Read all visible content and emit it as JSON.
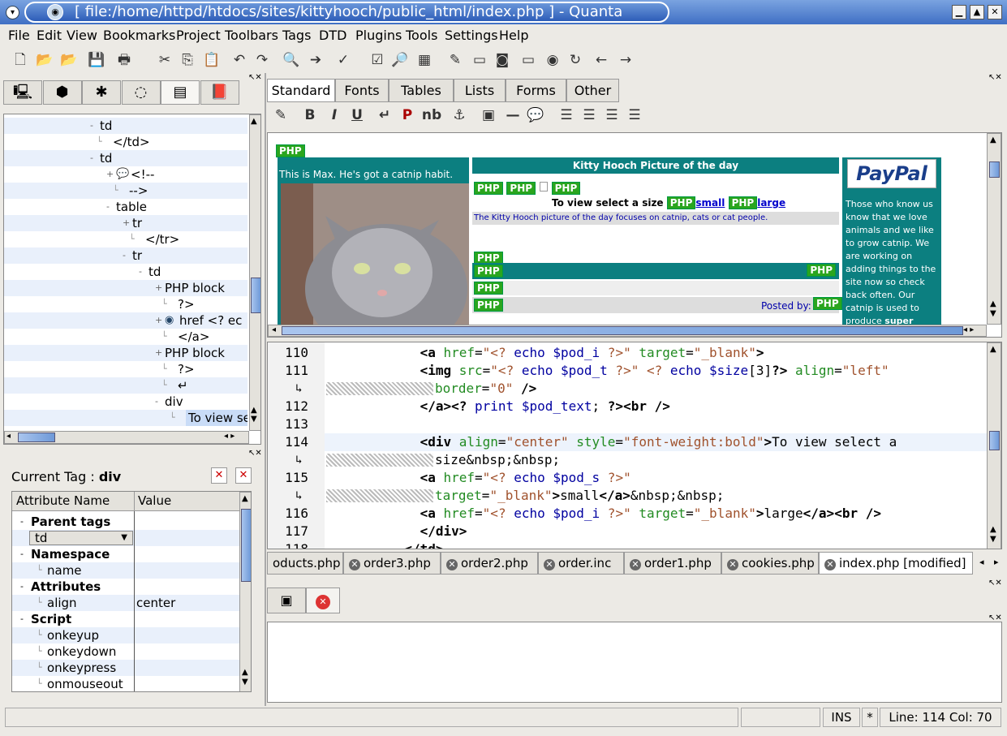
{
  "window": {
    "title": "[  file:/home/httpd/htdocs/sites/kittyhooch/public_html/index.php  ]  - Quanta"
  },
  "menu": [
    "File",
    "Edit",
    "View",
    "Bookmarks",
    "Project",
    "Toolbars",
    "Tags",
    "DTD",
    "Plugins",
    "Tools",
    "Settings",
    "Help"
  ],
  "toolbar_icons": [
    "new-file-icon",
    "open-icon",
    "open-recent-icon",
    "save-icon",
    "print-icon",
    "cut-icon",
    "copy-icon",
    "paste-icon",
    "undo-icon",
    "redo-icon",
    "find-icon",
    "find-next-icon",
    "spellcheck-icon",
    "checkbox-icon",
    "preview-icon",
    "tag-icon",
    "edit-icon",
    "page-icon",
    "view-icon",
    "page2-icon",
    "eye-icon",
    "reload-icon",
    "back-icon",
    "forward-icon"
  ],
  "left_tabs": [
    "computer-icon",
    "objects-icon",
    "document-icon",
    "globe-icon",
    "structure-icon",
    "book-icon"
  ],
  "structure_tree": [
    {
      "indent": 110,
      "label": "td",
      "expander": "-"
    },
    {
      "indent": 126,
      "label": "</td>",
      "expander": ""
    },
    {
      "indent": 110,
      "label": "td",
      "expander": "-"
    },
    {
      "indent": 130,
      "label": "<!--",
      "expander": "+",
      "icon": "comment-icon"
    },
    {
      "indent": 146,
      "label": "-->",
      "expander": ""
    },
    {
      "indent": 130,
      "label": "table",
      "expander": "-"
    },
    {
      "indent": 150,
      "label": "tr",
      "expander": "+"
    },
    {
      "indent": 166,
      "label": "</tr>",
      "expander": ""
    },
    {
      "indent": 150,
      "label": "tr",
      "expander": "-"
    },
    {
      "indent": 170,
      "label": "td",
      "expander": "-"
    },
    {
      "indent": 190,
      "label": "PHP block",
      "expander": "+"
    },
    {
      "indent": 206,
      "label": "?>",
      "expander": ""
    },
    {
      "indent": 190,
      "label": "href <? ec",
      "expander": "+",
      "icon": "link-icon"
    },
    {
      "indent": 206,
      "label": "</a>",
      "expander": ""
    },
    {
      "indent": 190,
      "label": "PHP block",
      "expander": "+"
    },
    {
      "indent": 206,
      "label": "?>",
      "expander": ""
    },
    {
      "indent": 206,
      "label": "↵",
      "expander": ""
    },
    {
      "indent": 190,
      "label": "div",
      "expander": "-"
    },
    {
      "indent": 216,
      "label": "To view se",
      "expander": "",
      "selected": true
    }
  ],
  "attr_panel": {
    "current_tag_label": "Current Tag : ",
    "current_tag": "div",
    "col_name": "Attribute Name",
    "col_value": "Value",
    "rows": [
      {
        "kind": "group",
        "name": "Parent tags",
        "value": ""
      },
      {
        "kind": "combo",
        "name": "td",
        "value": ""
      },
      {
        "kind": "group",
        "name": "Namespace",
        "value": ""
      },
      {
        "kind": "item",
        "name": "name",
        "value": ""
      },
      {
        "kind": "group",
        "name": "Attributes",
        "value": ""
      },
      {
        "kind": "item",
        "name": "align",
        "value": "center"
      },
      {
        "kind": "group",
        "name": "Script",
        "value": ""
      },
      {
        "kind": "item",
        "name": "onkeyup",
        "value": ""
      },
      {
        "kind": "item",
        "name": "onkeydown",
        "value": ""
      },
      {
        "kind": "item",
        "name": "onkeypress",
        "value": ""
      },
      {
        "kind": "item",
        "name": "onmouseout",
        "value": ""
      }
    ]
  },
  "tag_tabs": [
    "Standard",
    "Fonts",
    "Tables",
    "Lists",
    "Forms",
    "Other"
  ],
  "format_buttons": [
    "quick-start-icon",
    "B",
    "I",
    "U",
    "↵",
    "P",
    "nb",
    "anchor-icon",
    "image-icon",
    "hr-icon",
    "comment-icon",
    "align-left-icon",
    "align-center-icon",
    "align-right-icon",
    "justify-icon"
  ],
  "preview": {
    "php": "PHP",
    "caption_left": "This is Max. He's got a catnip habit.",
    "center_title": "Kitty Hooch Picture of the day",
    "view_text": "To view select a size",
    "small": "small",
    "large": "large",
    "focus_text": "The Kitty Hooch picture of the day focuses on catnip, cats or cat people.",
    "posted_by": "Posted by:",
    "paypal": "PayPal",
    "right_text": "Those who know us know that we love animals and we like to grow catnip. We are working on adding things to the site now so check back often. Our catnip is used to produce",
    "right_bold": "super"
  },
  "code_lines": [
    {
      "n": "110",
      "wrap": false,
      "parts": [
        [
          "",
          "            "
        ],
        [
          "kw",
          "<a"
        ],
        [
          "at",
          " href"
        ],
        [
          "",
          "="
        ],
        [
          "str",
          "\"<? "
        ],
        [
          "ph",
          "echo"
        ],
        [
          "vr",
          " $pod_i"
        ],
        [
          "str",
          " ?>\""
        ],
        [
          "at",
          " target"
        ],
        [
          "",
          "="
        ],
        [
          "str",
          "\"_blank\""
        ],
        [
          "kw",
          ">"
        ]
      ]
    },
    {
      "n": "111",
      "wrap": false,
      "parts": [
        [
          "",
          "            "
        ],
        [
          "kw",
          "<img"
        ],
        [
          "at",
          " src"
        ],
        [
          "",
          "="
        ],
        [
          "str",
          "\"<? "
        ],
        [
          "ph",
          "echo"
        ],
        [
          "vr",
          " $pod_t"
        ],
        [
          "str",
          " ?>\""
        ],
        [
          "str",
          " <? "
        ],
        [
          "ph",
          "echo"
        ],
        [
          "vr",
          " $size"
        ],
        [
          "",
          "[3]"
        ],
        [
          "kw",
          "?>"
        ],
        [
          "at",
          " align"
        ],
        [
          "",
          "="
        ],
        [
          "str",
          "\"left\""
        ]
      ]
    },
    {
      "n": "",
      "wrap": true,
      "parts": [
        [
          "at",
          "border"
        ],
        [
          "",
          "="
        ],
        [
          "str",
          "\"0\""
        ],
        [
          "kw",
          " />"
        ]
      ]
    },
    {
      "n": "112",
      "wrap": false,
      "parts": [
        [
          "",
          "            "
        ],
        [
          "kw",
          "</a>"
        ],
        [
          "kw",
          "<?"
        ],
        [
          "ph",
          " print"
        ],
        [
          "vr",
          " $pod_text"
        ],
        [
          "",
          ";"
        ],
        [
          "kw",
          " ?>"
        ],
        [
          "kw",
          "<br />"
        ]
      ]
    },
    {
      "n": "113",
      "wrap": false,
      "parts": []
    },
    {
      "n": "114",
      "wrap": false,
      "current": true,
      "parts": [
        [
          "",
          "            "
        ],
        [
          "kw",
          "<div"
        ],
        [
          "at",
          " align"
        ],
        [
          "",
          "="
        ],
        [
          "str",
          "\"center\""
        ],
        [
          "at",
          " style"
        ],
        [
          "",
          "="
        ],
        [
          "str",
          "\"font-weight:bold\""
        ],
        [
          "kw",
          ">"
        ],
        [
          "",
          "To view select a"
        ]
      ]
    },
    {
      "n": "",
      "wrap": true,
      "parts": [
        [
          "",
          "size&nbsp;&nbsp;"
        ]
      ]
    },
    {
      "n": "115",
      "wrap": false,
      "parts": [
        [
          "",
          "            "
        ],
        [
          "kw",
          "<a"
        ],
        [
          "at",
          " href"
        ],
        [
          "",
          "="
        ],
        [
          "str",
          "\"<? "
        ],
        [
          "ph",
          "echo"
        ],
        [
          "vr",
          " $pod_s"
        ],
        [
          "str",
          " ?>\""
        ]
      ]
    },
    {
      "n": "",
      "wrap": true,
      "parts": [
        [
          "at",
          "target"
        ],
        [
          "",
          "="
        ],
        [
          "str",
          "\"_blank\""
        ],
        [
          "kw",
          ">"
        ],
        [
          "",
          "small"
        ],
        [
          "kw",
          "</a>"
        ],
        [
          "",
          "&nbsp;&nbsp;"
        ]
      ]
    },
    {
      "n": "116",
      "wrap": false,
      "parts": [
        [
          "",
          "            "
        ],
        [
          "kw",
          "<a"
        ],
        [
          "at",
          " href"
        ],
        [
          "",
          "="
        ],
        [
          "str",
          "\"<? "
        ],
        [
          "ph",
          "echo"
        ],
        [
          "vr",
          " $pod_i"
        ],
        [
          "str",
          " ?>\""
        ],
        [
          "at",
          " target"
        ],
        [
          "",
          "="
        ],
        [
          "str",
          "\"_blank\""
        ],
        [
          "kw",
          ">"
        ],
        [
          "",
          "large"
        ],
        [
          "kw",
          "</a>"
        ],
        [
          "kw",
          "<br />"
        ]
      ]
    },
    {
      "n": "117",
      "wrap": false,
      "parts": [
        [
          "",
          "            "
        ],
        [
          "kw",
          "</div>"
        ]
      ]
    },
    {
      "n": "118",
      "wrap": false,
      "parts": [
        [
          "",
          "          "
        ],
        [
          "kw",
          "</td>"
        ]
      ]
    }
  ],
  "file_tabs": [
    {
      "label": "oducts.php",
      "close": false
    },
    {
      "label": "order3.php",
      "close": true
    },
    {
      "label": "order2.php",
      "close": true
    },
    {
      "label": "order.inc",
      "close": true
    },
    {
      "label": "order1.php",
      "close": true
    },
    {
      "label": "cookies.php",
      "close": true
    },
    {
      "label": "index.php [modified]",
      "close": true,
      "active": true
    }
  ],
  "bottom_tabs": [
    "messages-icon",
    "problems-icon"
  ],
  "status": {
    "ins": "INS",
    "mod": "*",
    "pos": "Line: 114 Col: 70"
  }
}
